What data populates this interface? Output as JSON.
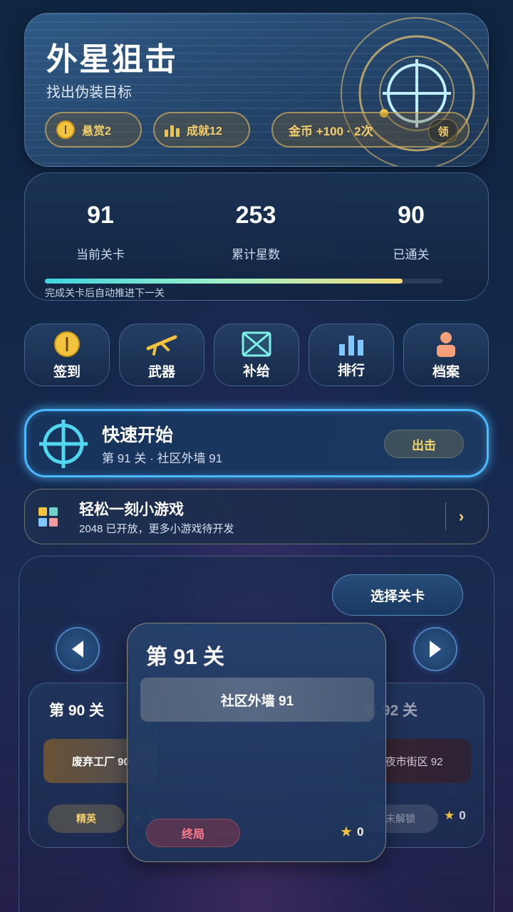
{
  "header": {
    "title": "外星狙击",
    "subtitle": "找出伪装目标",
    "bounty_label": "悬赏2",
    "achievement_label": "成就12",
    "coin_reward_label": "金币 +100 · 2次",
    "claim_label": "领"
  },
  "stats": {
    "current_level_value": "91",
    "current_level_label": "当前关卡",
    "total_stars_value": "253",
    "total_stars_label": "累计星数",
    "cleared_value": "90",
    "cleared_label": "已通关",
    "progress": 0.9,
    "progress_note": "完成关卡后自动推进下一关"
  },
  "quick_actions": [
    {
      "label": "签到",
      "icon": "coin-icon"
    },
    {
      "label": "武器",
      "icon": "rifle-icon"
    },
    {
      "label": "补给",
      "icon": "supply-box-icon"
    },
    {
      "label": "排行",
      "icon": "bar-chart-icon"
    },
    {
      "label": "档案",
      "icon": "profile-icon"
    }
  ],
  "quick_start": {
    "title": "快速开始",
    "subtitle": "第 91 关 · 社区外墙 91",
    "button": "出击"
  },
  "mini_game": {
    "title": "轻松一刻小游戏",
    "subtitle": "2048 已开放，更多小游戏待开发",
    "arrow": "›"
  },
  "level_selector": {
    "select_button": "选择关卡",
    "prev_card": {
      "title": "第 90 关",
      "scene": "废弃工厂 90",
      "tag": "精英",
      "stars": "3"
    },
    "current_card": {
      "title": "第 91 关",
      "scene": "社区外墙 91",
      "tag": "终局",
      "stars": "0"
    },
    "next_card": {
      "title": "第 92 关",
      "scene": "夜市街区 92",
      "tag": "未解锁",
      "stars": "0"
    }
  },
  "colors": {
    "accent_gold": "#f2c33e",
    "accent_cyan": "#4bb8ff",
    "danger_red": "#ff7e8c"
  }
}
